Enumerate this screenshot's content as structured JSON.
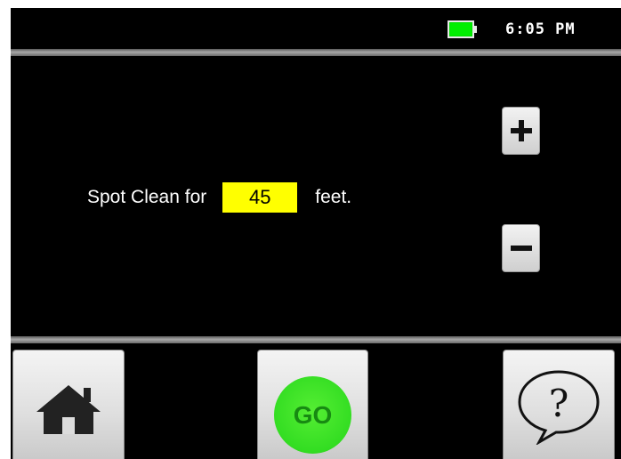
{
  "status_bar": {
    "battery": {
      "icon": "battery-icon",
      "level": 1.0,
      "color": "#00dd00"
    },
    "time": "6:05 PM"
  },
  "main": {
    "prompt_prefix": "Spot Clean for",
    "feet_value": "45",
    "prompt_suffix": "feet.",
    "value_highlight_color": "#ffff00",
    "increment_icon": "plus-icon",
    "decrement_icon": "minus-icon"
  },
  "bottom_nav": {
    "home_icon": "home-icon",
    "go_label": "GO",
    "go_color": "#33dd22",
    "help_icon": "help-question-bubble-icon",
    "help_glyph": "?"
  }
}
